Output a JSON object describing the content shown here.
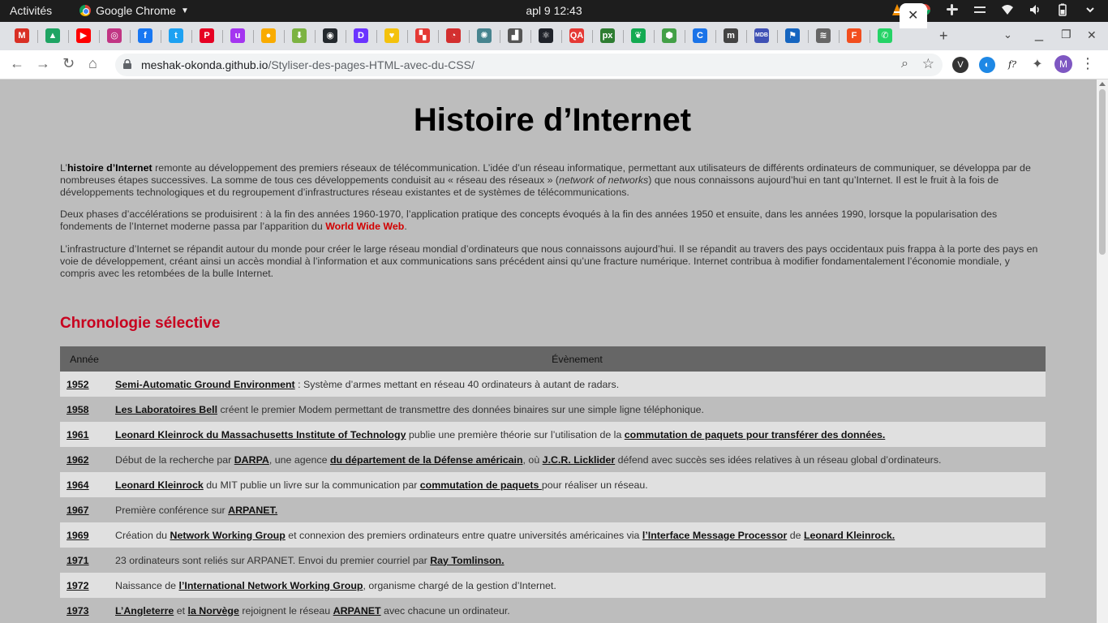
{
  "system_bar": {
    "activities": "Activités",
    "app_name": "Google Chrome",
    "clock": "apl 9  12:43"
  },
  "browser": {
    "url_host": "meshak-okonda.github.io",
    "url_path": "/Styliser-des-pages-HTML-avec-du-CSS/",
    "profile_initial": "M",
    "tab_icons": [
      {
        "name": "gmail-icon",
        "glyph": "M",
        "color": "#d93025"
      },
      {
        "name": "google-drive-icon",
        "glyph": "▲",
        "color": "#1fa463"
      },
      {
        "name": "youtube-icon",
        "glyph": "▶",
        "color": "#ff0000"
      },
      {
        "name": "instagram-icon",
        "glyph": "◎",
        "color": "#c13584"
      },
      {
        "name": "facebook-icon",
        "glyph": "f",
        "color": "#1877f2"
      },
      {
        "name": "twitter-icon",
        "glyph": "t",
        "color": "#1da1f2"
      },
      {
        "name": "pinterest-icon",
        "glyph": "P",
        "color": "#e60023"
      },
      {
        "name": "udemy-icon",
        "glyph": "u",
        "color": "#a435f0"
      },
      {
        "name": "notes-icon",
        "glyph": "●",
        "color": "#f9ab00"
      },
      {
        "name": "download-icon",
        "glyph": "⬇",
        "color": "#7cb342"
      },
      {
        "name": "github-icon",
        "glyph": "◉",
        "color": "#24292e"
      },
      {
        "name": "dailydev-icon",
        "glyph": "D",
        "color": "#6b34ff"
      },
      {
        "name": "heart-icon",
        "glyph": "♥",
        "color": "#f4c20d"
      },
      {
        "name": "puzzle-app-icon",
        "glyph": "▚",
        "color": "#e53935"
      },
      {
        "name": "clock-app-icon",
        "glyph": "◔",
        "color": "#d32f2f"
      },
      {
        "name": "electron-icon",
        "glyph": "✺",
        "color": "#47848f"
      },
      {
        "name": "stairs-icon",
        "glyph": "▟",
        "color": "#555555"
      },
      {
        "name": "react-icon",
        "glyph": "⚛",
        "color": "#20232a"
      },
      {
        "name": "qa-icon",
        "glyph": "QA",
        "color": "#e53935"
      },
      {
        "name": "px-icon",
        "glyph": "px",
        "color": "#2e7d32"
      },
      {
        "name": "mongodb-icon",
        "glyph": "❦",
        "color": "#13aa52"
      },
      {
        "name": "node-icon",
        "glyph": "⬢",
        "color": "#43a047"
      },
      {
        "name": "c-app-icon",
        "glyph": "C",
        "color": "#1a73e8"
      },
      {
        "name": "medium-icon",
        "glyph": "m",
        "color": "#444444"
      },
      {
        "name": "mdb-icon",
        "glyph": "MDB",
        "color": "#3f51b5"
      },
      {
        "name": "flag-icon",
        "glyph": "⚑",
        "color": "#1565c0"
      },
      {
        "name": "feather-icon",
        "glyph": "≋",
        "color": "#666666"
      },
      {
        "name": "figma-icon",
        "glyph": "F",
        "color": "#f24e1e"
      },
      {
        "name": "whatsapp-icon",
        "glyph": "✆",
        "color": "#25d366"
      }
    ]
  },
  "page": {
    "title": "Histoire d’Internet",
    "p1_strong": "histoire d’Internet",
    "p1_prefix": "L’",
    "p1_rest": " remonte au développement des premiers réseaux de télécommunication. L’idée d’un réseau informatique, permettant aux utilisateurs de différents ordinateurs de communiquer, se développa par de nombreuses étapes successives. La somme de tous ces développements conduisit au « réseau des réseaux » (",
    "p1_italic": "network of networks",
    "p1_end": ") que nous connaissons aujourd’hui en tant qu’Internet. Il est le fruit à la fois de développements technologiques et du regroupement d’infrastructures réseau existantes et de systèmes de télécommunications.",
    "p2_text": "Deux phases d’accélérations se produisirent : à la fin des années 1960-1970, l’application pratique des concepts évoqués à la fin des années 1950 et ensuite, dans les années 1990, lorsque la popularisation des fondements de l’Internet moderne passa par l’apparition du ",
    "p2_link": "World Wide Web",
    "p2_end": ".",
    "p3_text": "L’infrastructure d’Internet se répandit autour du monde pour créer le large réseau mondial d’ordinateurs que nous connaissons aujourd’hui. Il se répandit au travers des pays occidentaux puis frappa à la porte des pays en voie de développement, créant ainsi un accès mondial à l’information et aux communications sans précédent ainsi qu’une fracture numérique. Internet contribua à modifier fondamentalement l’économie mondiale, y compris avec les retombées de la bulle Internet.",
    "section_title": "Chronologie sélective",
    "table_headers": [
      "Année",
      "Évènement"
    ],
    "rows": [
      {
        "year": "1952",
        "parts": [
          {
            "t": "Semi-Automatic Ground Environment",
            "link": true
          },
          {
            "t": " : Système d’armes mettant en réseau 40 ordinateurs à autant de radars."
          }
        ]
      },
      {
        "year": "1958",
        "parts": [
          {
            "t": "Les Laboratoires Bell",
            "link": true
          },
          {
            "t": " créent le premier Modem permettant de transmettre des données binaires sur une simple ligne téléphonique."
          }
        ]
      },
      {
        "year": "1961",
        "parts": [
          {
            "t": "Leonard Kleinrock du Massachusetts Institute of Technology",
            "link": true
          },
          {
            "t": " publie une première théorie sur l’utilisation de la "
          },
          {
            "t": "commutation de paquets pour transférer des données.",
            "link": true
          }
        ]
      },
      {
        "year": "1962",
        "parts": [
          {
            "t": "Début de la recherche par "
          },
          {
            "t": "DARPA",
            "link": true
          },
          {
            "t": ", une agence "
          },
          {
            "t": "du département de la Défense américain",
            "link": true
          },
          {
            "t": ", où "
          },
          {
            "t": "J.C.R. Licklider",
            "link": true
          },
          {
            "t": " défend avec succès ses idées relatives à un réseau global d’ordinateurs."
          }
        ]
      },
      {
        "year": "1964",
        "parts": [
          {
            "t": "Leonard Kleinrock",
            "link": true
          },
          {
            "t": " du MIT publie un livre sur la communication par "
          },
          {
            "t": "commutation de paquets ",
            "link": true
          },
          {
            "t": "pour réaliser un réseau."
          }
        ]
      },
      {
        "year": "1967",
        "parts": [
          {
            "t": "Première conférence sur "
          },
          {
            "t": "ARPANET.",
            "link": true
          }
        ]
      },
      {
        "year": "1969",
        "parts": [
          {
            "t": "Création du "
          },
          {
            "t": "Network Working Group",
            "link": true
          },
          {
            "t": " et connexion des premiers ordinateurs entre quatre universités américaines via "
          },
          {
            "t": "l’Interface Message Processor",
            "link": true
          },
          {
            "t": " de "
          },
          {
            "t": "Leonard Kleinrock.",
            "link": true
          }
        ]
      },
      {
        "year": "1971",
        "parts": [
          {
            "t": "23 ordinateurs sont reliés sur ARPANET. Envoi du premier courriel par "
          },
          {
            "t": "Ray Tomlinson.",
            "link": true
          }
        ]
      },
      {
        "year": "1972",
        "parts": [
          {
            "t": "Naissance de "
          },
          {
            "t": "l’International Network Working Group",
            "link": true
          },
          {
            "t": ", organisme chargé de la gestion d’Internet."
          }
        ]
      },
      {
        "year": "1973",
        "parts": [
          {
            "t": "L’Angleterre",
            "link": true
          },
          {
            "t": " et "
          },
          {
            "t": "la Norvège",
            "link": true
          },
          {
            "t": " rejoignent le réseau "
          },
          {
            "t": "ARPANET",
            "link": true
          },
          {
            "t": " avec chacune un ordinateur."
          }
        ]
      }
    ]
  }
}
